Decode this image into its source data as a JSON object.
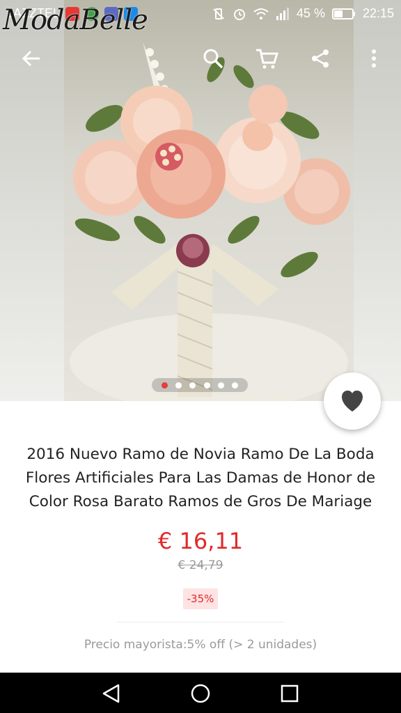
{
  "status_bar": {
    "carrier": "JAZZTEL",
    "battery_percent": "45 %",
    "time": "22:15"
  },
  "brand": {
    "logo_text": "ModaBelle"
  },
  "toolbar": {
    "back_icon": "arrow-left-icon",
    "search_icon": "search-icon",
    "cart_icon": "cart-icon",
    "share_icon": "share-icon",
    "more_icon": "more-vert-icon"
  },
  "gallery": {
    "image_count": 6,
    "active_index": 0
  },
  "wishlist": {
    "icon": "heart-icon"
  },
  "product": {
    "title": "2016 Nuevo Ramo de Novia Ramo De La Boda Flores Artificiales Para Las Damas de Honor de Color Rosa Barato Ramos de Gros De Mariage",
    "price": "€ 16,11",
    "original_price": "€ 24,79",
    "discount": "-35%",
    "wholesale_info": "Precio mayorista:5% off (> 2 unidades)"
  },
  "colors": {
    "price_red": "#e02a2a",
    "discount_bg": "#fde3e3",
    "muted_text": "#9a9a9a"
  },
  "nav_bar": {
    "back": "triangle-back-icon",
    "home": "circle-home-icon",
    "recents": "square-recents-icon"
  }
}
